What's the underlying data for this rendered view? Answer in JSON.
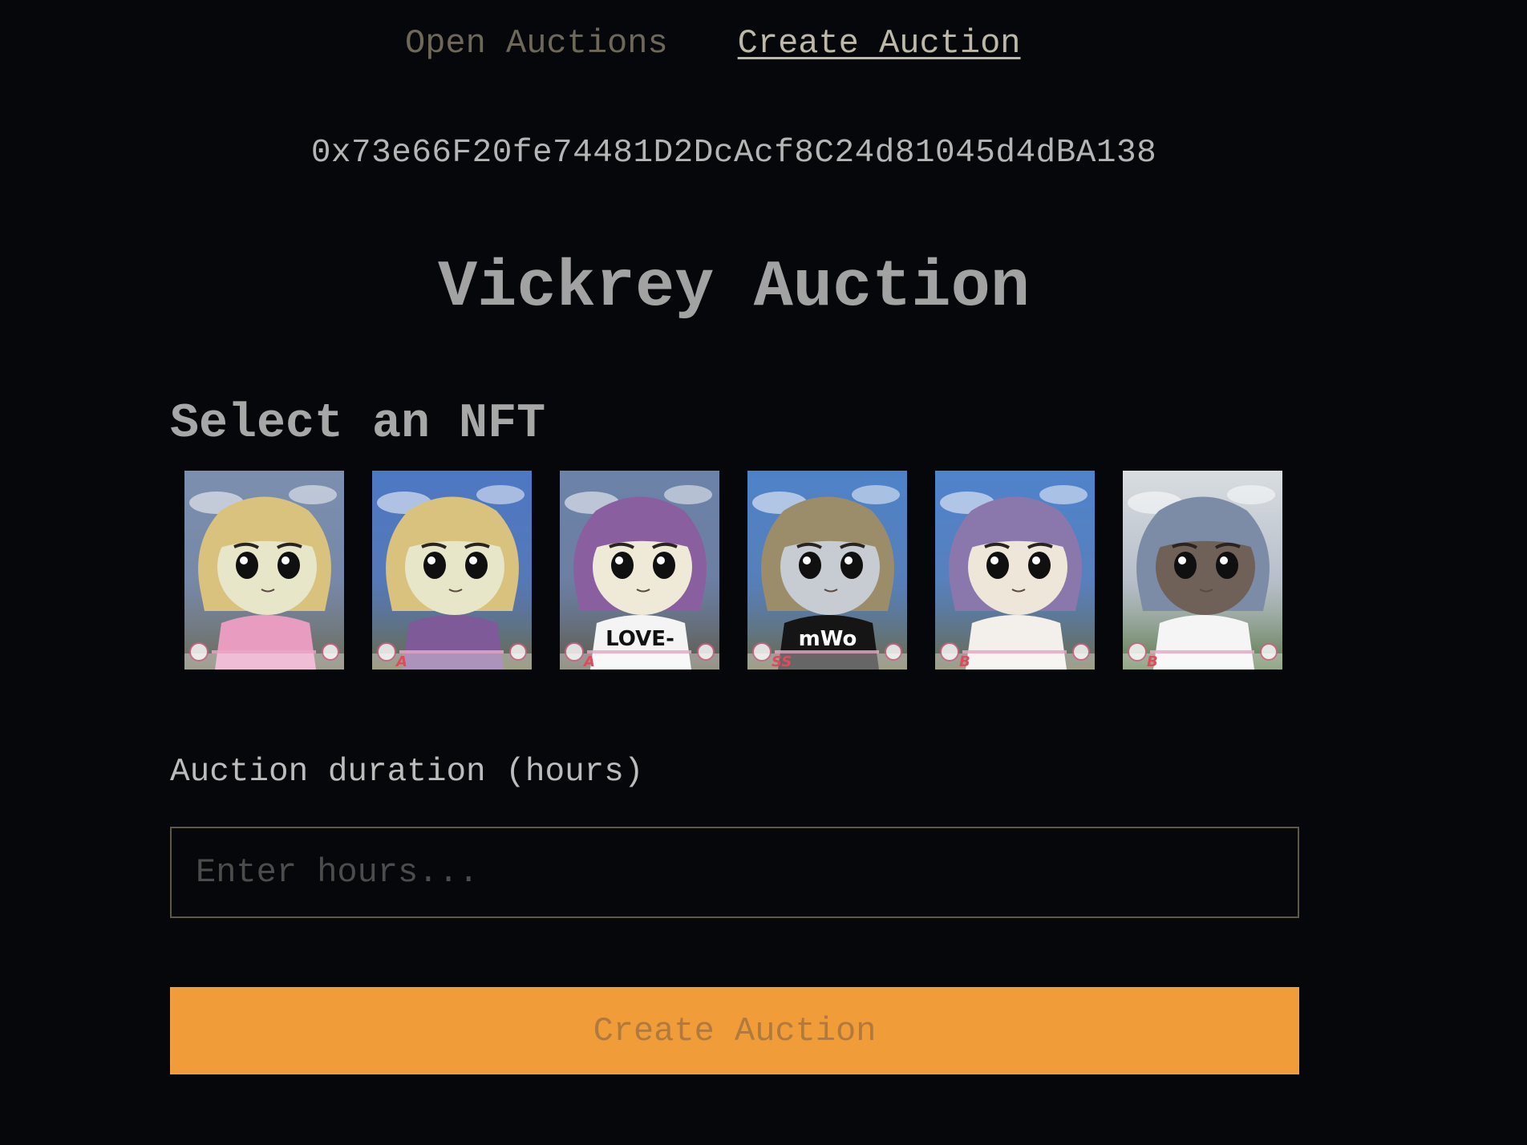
{
  "nav": {
    "open_auctions": "Open Auctions",
    "create_auction": "Create Auction"
  },
  "wallet_address": "0x73e66F20fe74481D2DcAcf8C24d81045d4dBA138",
  "page_title": "Vickrey Auction",
  "nft_section": {
    "title": "Select an NFT",
    "items": [
      {
        "hair": "#d8c27e",
        "skin": "#e8e6c8",
        "shirt": "#e79cc0",
        "bg_top": "#7c8fae",
        "bg_bottom": "#6c6a55",
        "shirt_text": "",
        "rank": ""
      },
      {
        "hair": "#d8c27e",
        "skin": "#e8e6c8",
        "shirt": "#7e5a98",
        "bg_top": "#4d78c4",
        "bg_bottom": "#6c6a45",
        "shirt_text": "",
        "rank": "A"
      },
      {
        "hair": "#8a5fa0",
        "skin": "#efe9d8",
        "shirt": "#f4f4f4",
        "bg_top": "#6c82a8",
        "bg_bottom": "#5f5a48",
        "shirt_text": "LOVE-",
        "rank": "A"
      },
      {
        "hair": "#9c8d6a",
        "skin": "#c6ccd2",
        "shirt": "#151515",
        "bg_top": "#4e82c8",
        "bg_bottom": "#6d6a48",
        "shirt_text": "mWo",
        "rank": "SS"
      },
      {
        "hair": "#8a78ac",
        "skin": "#efe6da",
        "shirt": "#f3f0ec",
        "bg_top": "#4f83cc",
        "bg_bottom": "#6a6a48",
        "shirt_text": "",
        "rank": "B"
      },
      {
        "hair": "#7d8ca6",
        "skin": "#6f6058",
        "shirt": "#f5f5f5",
        "bg_top": "#d8dde0",
        "bg_bottom": "#5b7848",
        "shirt_text": "",
        "rank": "B"
      }
    ]
  },
  "duration": {
    "label": "Auction duration (hours)",
    "placeholder": "Enter hours...",
    "value": ""
  },
  "create_button_label": "Create Auction",
  "colors": {
    "background": "#05070a",
    "button": "#f09c38",
    "input_border": "#5f5846"
  }
}
